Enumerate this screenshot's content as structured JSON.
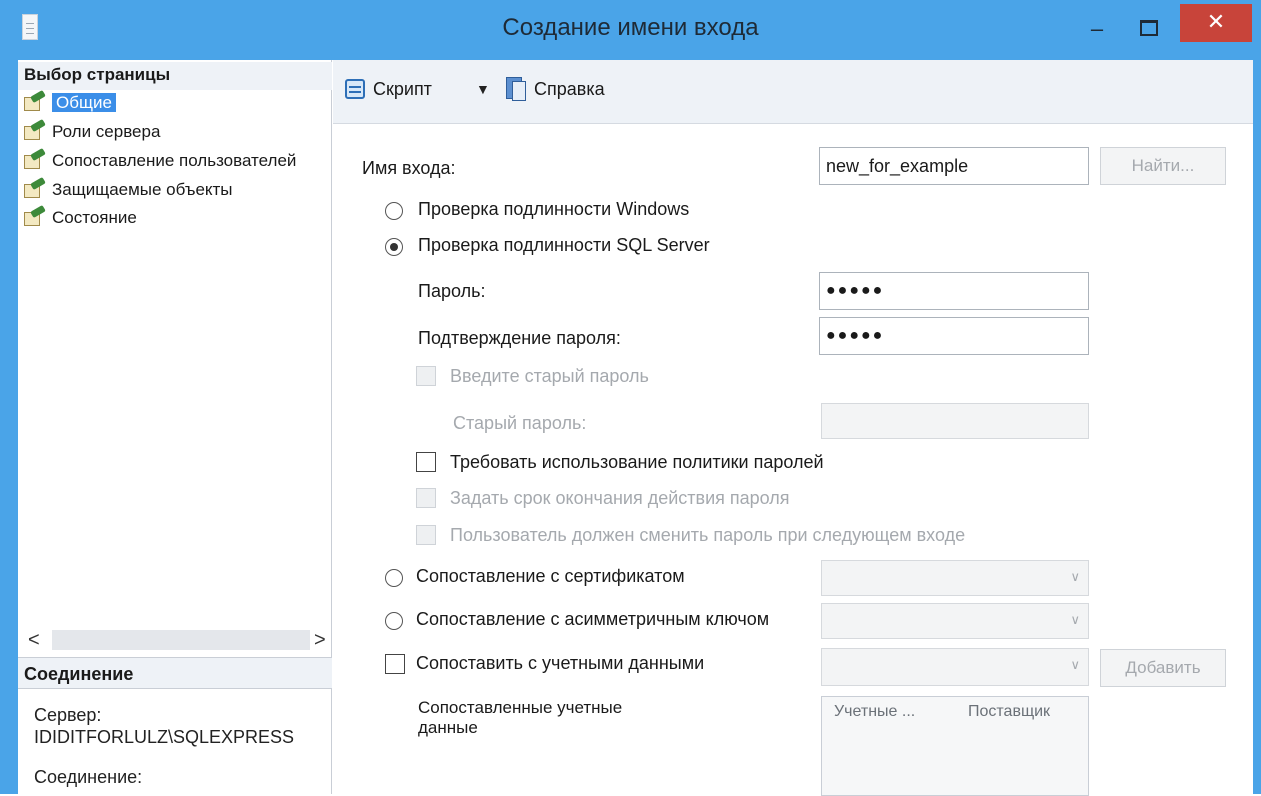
{
  "window": {
    "title": "Создание имени входа",
    "minimize_glyph": "–",
    "close_glyph": "✕"
  },
  "left": {
    "pages_header": "Выбор страницы",
    "pages": [
      {
        "label": "Общие",
        "icon": "page-wrench-icon",
        "selected": true
      },
      {
        "label": "Роли сервера",
        "icon": "page-wrench-icon"
      },
      {
        "label": "Сопоставление пользователей",
        "icon": "page-wrench-icon"
      },
      {
        "label": "Защищаемые объекты",
        "icon": "page-wrench-icon"
      },
      {
        "label": "Состояние",
        "icon": "page-wrench-icon"
      }
    ],
    "scroll_left": "<",
    "scroll_right": ">",
    "connection_header": "Соединение",
    "server_label": "Сервер:",
    "server_value": "IDIDITFORLULZ\\SQLEXPRESS",
    "connection_label": "Соединение:"
  },
  "toolbar": {
    "script_label": "Скрипт",
    "script_dropdown": "▼",
    "help_label": "Справка"
  },
  "form": {
    "login_name_label": "Имя входа:",
    "login_name_value": "new_for_example",
    "find_button": "Найти...",
    "auth_windows": "Проверка подлинности Windows",
    "auth_sql": "Проверка подлинности SQL Server",
    "auth_selected": "sql",
    "password_label": "Пароль:",
    "password_value": "●●●●●",
    "confirm_label": "Подтверждение пароля:",
    "confirm_value": "●●●●●",
    "old_password_check": "Введите старый пароль",
    "old_password_label": "Старый пароль:",
    "enforce_policy": "Требовать использование политики паролей",
    "enforce_expiration": "Задать срок окончания действия пароля",
    "must_change": "Пользователь должен сменить пароль при следующем входе",
    "map_certificate": "Сопоставление с сертификатом",
    "map_asym_key": "Сопоставление с асимметричным ключом",
    "map_credentials": "Сопоставить с учетными данными",
    "add_button": "Добавить",
    "mapped_credentials_label": "Сопоставленные учетные данные",
    "grid_col_credentials": "Учетные ...",
    "grid_col_provider": "Поставщик",
    "combo_caret": "∨"
  },
  "colors": {
    "titlebar": "#4aa4e8",
    "close_button": "#c8443a",
    "selection": "#3b8ee8",
    "disabled_text": "#a5a9ae"
  }
}
